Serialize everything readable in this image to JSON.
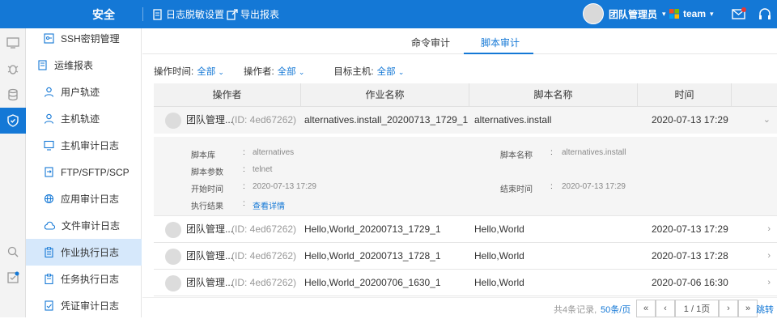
{
  "topbar": {
    "title": "安全",
    "desensitize_label": "日志脱敏设置",
    "export_label": "导出报表",
    "user_name": "团队管理员",
    "team_name": "team"
  },
  "sidebar": {
    "items": [
      {
        "label": "SSH密钥管理"
      },
      {
        "label": "运维报表"
      },
      {
        "label": "用户轨迹"
      },
      {
        "label": "主机轨迹"
      },
      {
        "label": "主机审计日志"
      },
      {
        "label": "FTP/SFTP/SCP"
      },
      {
        "label": "应用审计日志"
      },
      {
        "label": "文件审计日志"
      },
      {
        "label": "作业执行日志"
      },
      {
        "label": "任务执行日志"
      },
      {
        "label": "凭证审计日志"
      }
    ]
  },
  "tabs": [
    "命令审计",
    "脚本审计"
  ],
  "filters": {
    "time_label": "操作时间:",
    "time_value": "全部",
    "operator_label": "操作者:",
    "operator_value": "全部",
    "host_label": "目标主机:",
    "host_value": "全部"
  },
  "table": {
    "headers": [
      "操作者",
      "作业名称",
      "脚本名称",
      "时间"
    ],
    "rows": [
      {
        "user": "团队管理...",
        "id": "(ID: 4ed67262)",
        "job": "alternatives.install_20200713_1729_1",
        "script": "alternatives.install",
        "time": "2020-07-13 17:29"
      },
      {
        "user": "团队管理...",
        "id": "(ID: 4ed67262)",
        "job": "Hello,World_20200713_1729_1",
        "script": "Hello,World",
        "time": "2020-07-13 17:29"
      },
      {
        "user": "团队管理...",
        "id": "(ID: 4ed67262)",
        "job": "Hello,World_20200713_1728_1",
        "script": "Hello,World",
        "time": "2020-07-13 17:28"
      },
      {
        "user": "团队管理...",
        "id": "(ID: 4ed67262)",
        "job": "Hello,World_20200706_1630_1",
        "script": "Hello,World",
        "time": "2020-07-06 16:30"
      }
    ]
  },
  "detail": {
    "lib_label": "脚本库",
    "lib_value": "alternatives",
    "param_label": "脚本参数",
    "param_value": "telnet",
    "start_label": "开始时间",
    "start_value": "2020-07-13 17:29",
    "result_label": "执行结果",
    "result_value": "查看详情",
    "name_label": "脚本名称",
    "name_value": "alternatives.install",
    "end_label": "结束时间",
    "end_value": "2020-07-13 17:29",
    "colon": ":"
  },
  "pager": {
    "total": "共4条记录,",
    "page_size": "50条/页",
    "first": "«",
    "prev": "‹",
    "page": "1 / 1页",
    "next": "›",
    "last": "»",
    "jump": "跳转"
  },
  "colors": {
    "accent": "#1478d6",
    "active_bg": "#d6e8fb"
  }
}
